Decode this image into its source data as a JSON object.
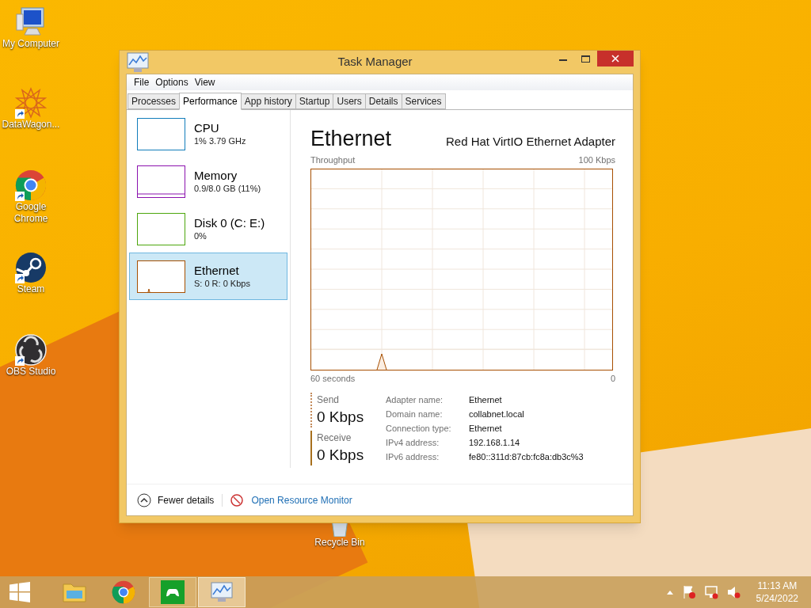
{
  "desktop": {
    "icons": [
      {
        "label": "My Computer",
        "kind": "computer",
        "shortcut": false
      },
      {
        "label": "DataWagon...",
        "kind": "star",
        "shortcut": true
      },
      {
        "label": "Google Chrome",
        "kind": "chrome",
        "shortcut": true
      },
      {
        "label": "Steam",
        "kind": "steam",
        "shortcut": true
      },
      {
        "label": "OBS Studio",
        "kind": "obs",
        "shortcut": true
      }
    ],
    "recycle_bin": {
      "label": "Recycle Bin"
    }
  },
  "window": {
    "title": "Task Manager",
    "menu": [
      "File",
      "Options",
      "View"
    ],
    "tabs": [
      {
        "label": "Processes",
        "selected": false
      },
      {
        "label": "Performance",
        "selected": true
      },
      {
        "label": "App history",
        "selected": false
      },
      {
        "label": "Startup",
        "selected": false
      },
      {
        "label": "Users",
        "selected": false
      },
      {
        "label": "Details",
        "selected": false
      },
      {
        "label": "Services",
        "selected": false
      }
    ],
    "sidebar": {
      "items": [
        {
          "name": "CPU",
          "detail": "1% 3.79 GHz",
          "color": "#117dbb",
          "selected": false
        },
        {
          "name": "Memory",
          "detail": "0.9/8.0 GB (11%)",
          "color": "#8b12ae",
          "selected": false
        },
        {
          "name": "Disk 0 (C: E:)",
          "detail": "0%",
          "color": "#4da60c",
          "selected": false
        },
        {
          "name": "Ethernet",
          "detail": "S: 0 R: 0 Kbps",
          "color": "#a74f01",
          "selected": true
        }
      ]
    },
    "detail": {
      "title": "Ethernet",
      "adapter": "Red Hat VirtIO Ethernet Adapter",
      "graph": {
        "label": "Throughput",
        "max": "100 Kbps",
        "span": "60 seconds",
        "min": "0"
      },
      "send": {
        "label": "Send",
        "value": "0 Kbps"
      },
      "receive": {
        "label": "Receive",
        "value": "0 Kbps"
      },
      "properties": [
        {
          "label": "Adapter name:",
          "value": "Ethernet"
        },
        {
          "label": "Domain name:",
          "value": "collabnet.local"
        },
        {
          "label": "Connection type:",
          "value": "Ethernet"
        },
        {
          "label": "IPv4 address:",
          "value": "192.168.1.14"
        },
        {
          "label": "IPv6 address:",
          "value": "fe80::311d:87cb:fc8a:db3c%3"
        }
      ]
    },
    "footer": {
      "fewer_details": "Fewer details",
      "resource_monitor": "Open Resource Monitor"
    }
  },
  "taskbar": {
    "apps": [
      {
        "kind": "explorer",
        "running": false,
        "selected": false
      },
      {
        "kind": "chrome",
        "running": false,
        "selected": false
      },
      {
        "kind": "games",
        "running": true,
        "selected": false
      },
      {
        "kind": "taskmanager",
        "running": true,
        "selected": true
      }
    ],
    "time": "11:13 AM",
    "date": "5/24/2022"
  }
}
